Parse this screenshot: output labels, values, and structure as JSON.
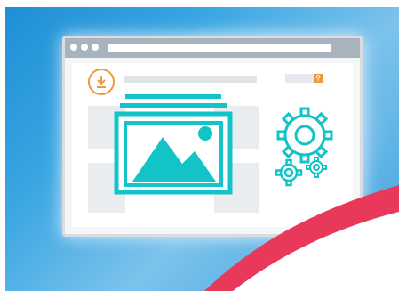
{
  "illustration": {
    "subject": "web-page-with-image-and-settings",
    "colors": {
      "background_blue": "#39a6e2",
      "window_frame": "#a9b3bd",
      "accent_teal": "#12c4c8",
      "accent_orange": "#ee9a3a",
      "accent_pink": "#e8395a"
    },
    "icons": [
      "download-icon",
      "search-icon",
      "image-gallery-icon",
      "gear-icon",
      "gear-small-icon"
    ]
  }
}
